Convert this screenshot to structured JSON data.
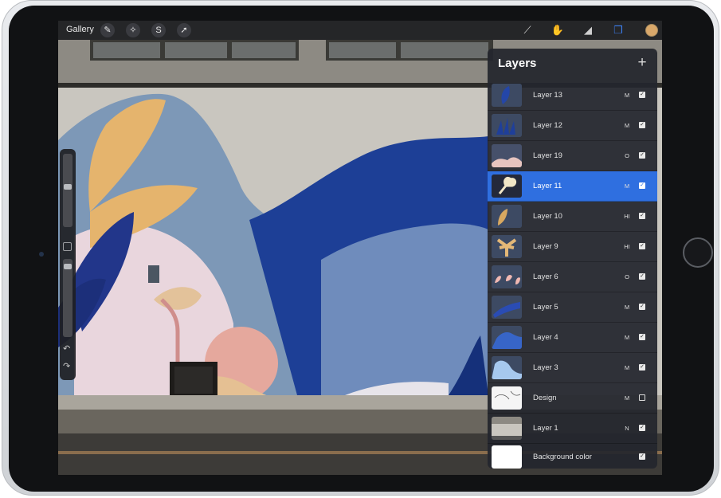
{
  "toolbar": {
    "gallery_label": "Gallery",
    "left_tools": [
      {
        "name": "actions-wrench-icon",
        "glyph": "✎"
      },
      {
        "name": "adjustments-wand-icon",
        "glyph": "✧"
      },
      {
        "name": "selection-icon",
        "glyph": "S"
      },
      {
        "name": "transform-arrow-icon",
        "glyph": "➚"
      }
    ],
    "right_tools": [
      {
        "name": "brush-icon",
        "glyph": "⟋"
      },
      {
        "name": "smudge-icon",
        "glyph": "✋"
      },
      {
        "name": "eraser-icon",
        "glyph": "◢"
      },
      {
        "name": "layers-icon",
        "glyph": "❐"
      }
    ],
    "active_tool": "layers-icon",
    "color": "#d9a86a",
    "accent": "#3d7ff0"
  },
  "layers_panel": {
    "title": "Layers",
    "add_button": "+",
    "layers": [
      {
        "name": "Layer 13",
        "blend": "M",
        "visible": true,
        "selected": false,
        "thumb": "leaf-blue"
      },
      {
        "name": "Layer 12",
        "blend": "M",
        "visible": true,
        "selected": false,
        "thumb": "grass-blue"
      },
      {
        "name": "Layer 19",
        "blend": "O",
        "visible": true,
        "selected": false,
        "thumb": "hills-pink"
      },
      {
        "name": "Layer 11",
        "blend": "M",
        "visible": true,
        "selected": true,
        "thumb": "flower-cream"
      },
      {
        "name": "Layer 10",
        "blend": "HI",
        "visible": true,
        "selected": false,
        "thumb": "leaf-tan"
      },
      {
        "name": "Layer 9",
        "blend": "HI",
        "visible": true,
        "selected": false,
        "thumb": "palm-tan"
      },
      {
        "name": "Layer 6",
        "blend": "O",
        "visible": true,
        "selected": false,
        "thumb": "petals-pink"
      },
      {
        "name": "Layer 5",
        "blend": "M",
        "visible": true,
        "selected": false,
        "thumb": "stripe-blue"
      },
      {
        "name": "Layer 4",
        "blend": "M",
        "visible": true,
        "selected": false,
        "thumb": "mountain-blue"
      },
      {
        "name": "Layer 3",
        "blend": "M",
        "visible": true,
        "selected": false,
        "thumb": "mountain-light"
      },
      {
        "name": "Design",
        "blend": "M",
        "visible": false,
        "selected": false,
        "thumb": "sketch"
      },
      {
        "name": "Layer 1",
        "blend": "N",
        "visible": true,
        "selected": false,
        "thumb": "photo"
      }
    ],
    "background": {
      "name": "Background color",
      "visible": true
    }
  }
}
